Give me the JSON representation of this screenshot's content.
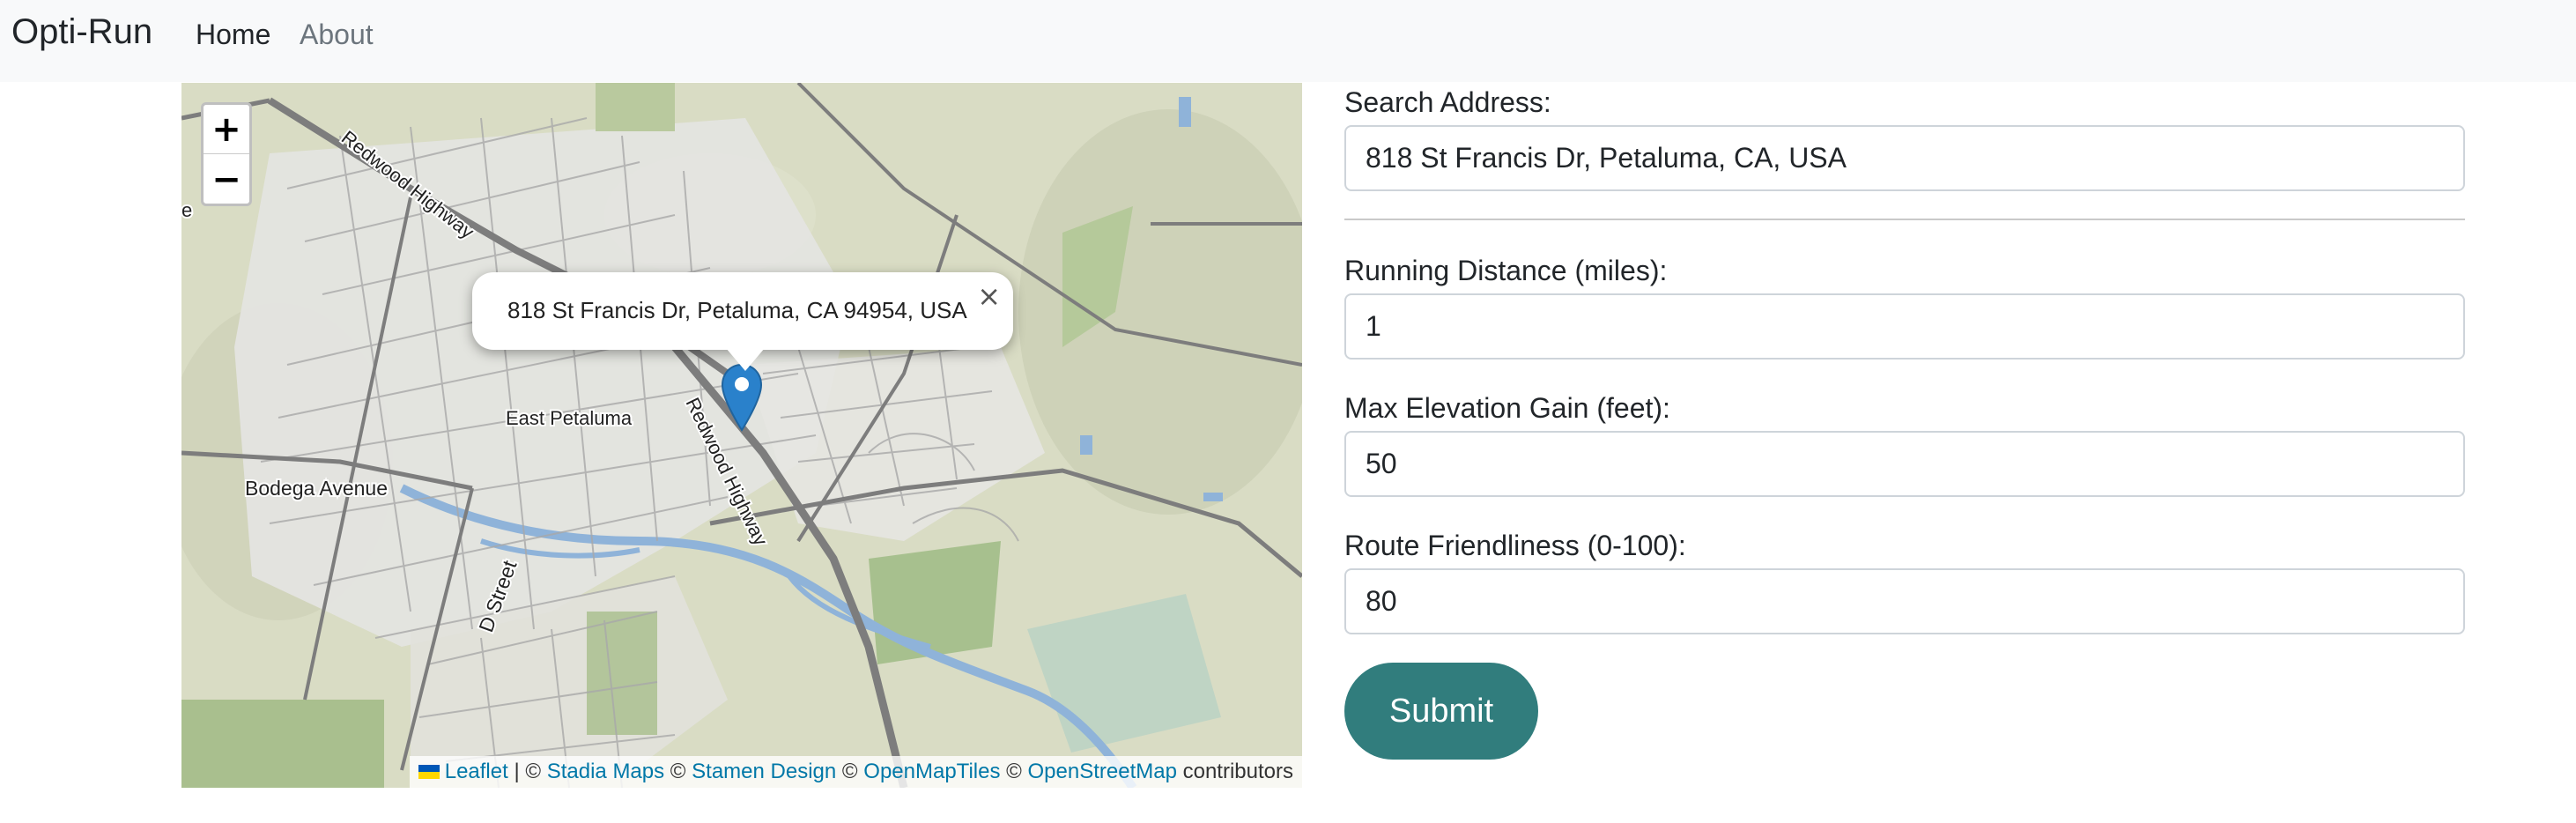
{
  "navbar": {
    "brand": "Opti-Run",
    "links": [
      {
        "label": "Home",
        "active": true
      },
      {
        "label": "About",
        "active": false
      }
    ]
  },
  "map": {
    "zoom_in": "+",
    "zoom_out": "−",
    "popup": {
      "text": "818 St Francis Dr, Petaluma, CA 94954, USA",
      "close": "×"
    },
    "labels": {
      "redwood_highway_north": "Redwood Highway",
      "redwood_highway_south": "Redwood Highway",
      "east_petaluma": "East Petaluma",
      "bodega_avenue": "Bodega Avenue",
      "d_street": "D Street",
      "edge_e": "e"
    },
    "attribution": {
      "leaflet": "Leaflet",
      "sep1": "| ©",
      "stadia": "Stadia Maps",
      "sep2": "©",
      "stamen": "Stamen Design",
      "sep3": "©",
      "openmaptiles": "OpenMapTiles",
      "sep4": "©",
      "osm": "OpenStreetMap",
      "contributors": "contributors"
    },
    "colors": {
      "land": "#d9dcc4",
      "park": "#9fb98a",
      "water": "#8fb3d9",
      "road": "#8a8a8a",
      "marker": "#2a81cb"
    }
  },
  "form": {
    "search_address": {
      "label": "Search Address:",
      "value": "818 St Francis Dr, Petaluma, CA, USA"
    },
    "running_distance": {
      "label": "Running Distance (miles):",
      "value": "1"
    },
    "max_elevation": {
      "label": "Max Elevation Gain (feet):",
      "value": "50"
    },
    "route_friendliness": {
      "label": "Route Friendliness (0-100):",
      "value": "80"
    },
    "submit_label": "Submit"
  }
}
